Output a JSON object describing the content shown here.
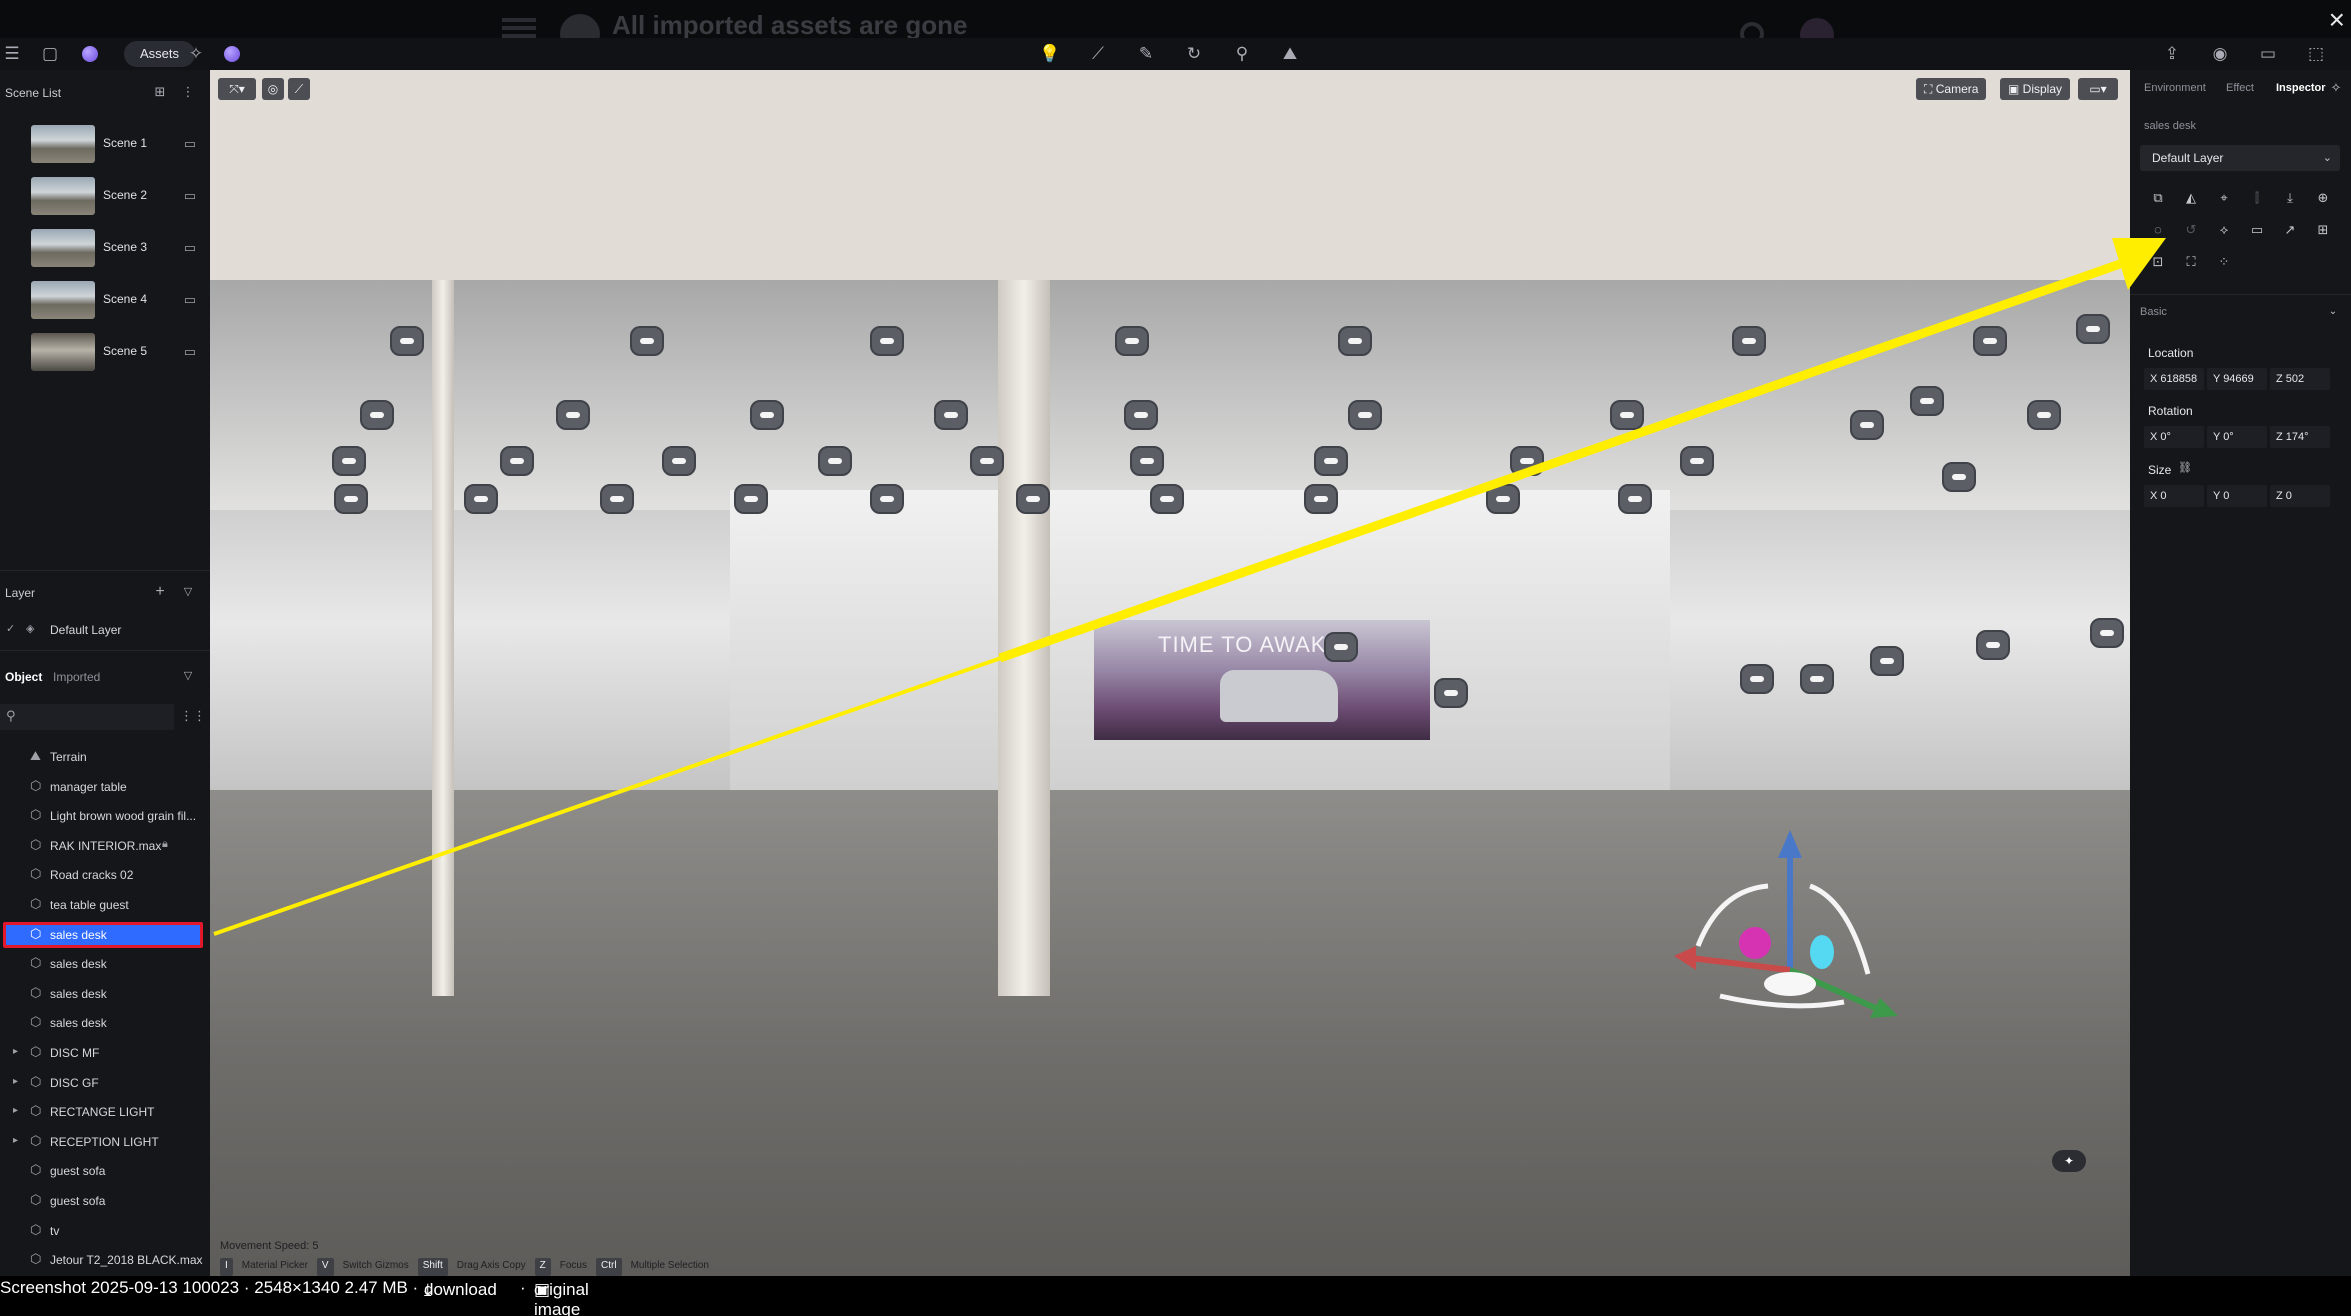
{
  "banner": {
    "title": "All imported assets are gone",
    "close_icon": "×"
  },
  "toolbar": {
    "assets_label": "Assets",
    "center_tools": [
      "lightbulb-icon",
      "measure-icon",
      "brush-icon",
      "rotate-icon",
      "path-icon",
      "terrain-icon"
    ]
  },
  "scene_list": {
    "title": "Scene List",
    "scenes": [
      {
        "label": "Scene 1"
      },
      {
        "label": "Scene 2"
      },
      {
        "label": "Scene 3"
      },
      {
        "label": "Scene 4"
      },
      {
        "label": "Scene 5"
      }
    ]
  },
  "layer": {
    "title": "Layer",
    "default_layer": "Default Layer"
  },
  "objects": {
    "tabs": {
      "object": "Object",
      "imported": "Imported"
    },
    "items": [
      {
        "label": "Terrain",
        "expandable": false,
        "selected": false
      },
      {
        "label": "manager table",
        "expandable": false,
        "selected": false
      },
      {
        "label": "Light brown wood grain fil...",
        "expandable": false,
        "selected": false
      },
      {
        "label": "RAK INTERIOR.max",
        "expandable": false,
        "selected": false
      },
      {
        "label": "Road cracks 02",
        "expandable": false,
        "selected": false
      },
      {
        "label": "tea table guest",
        "expandable": false,
        "selected": false
      },
      {
        "label": "sales desk",
        "expandable": false,
        "selected": true
      },
      {
        "label": "sales desk",
        "expandable": false,
        "selected": false
      },
      {
        "label": "sales desk",
        "expandable": false,
        "selected": false
      },
      {
        "label": "sales desk",
        "expandable": false,
        "selected": false
      },
      {
        "label": "DISC MF",
        "expandable": true,
        "selected": false
      },
      {
        "label": "DISC GF",
        "expandable": true,
        "selected": false
      },
      {
        "label": "RECTANGE LIGHT",
        "expandable": true,
        "selected": false
      },
      {
        "label": "RECEPTION LIGHT",
        "expandable": true,
        "selected": false
      },
      {
        "label": "guest sofa",
        "expandable": false,
        "selected": false
      },
      {
        "label": "guest sofa",
        "expandable": false,
        "selected": false
      },
      {
        "label": "tv",
        "expandable": false,
        "selected": false
      },
      {
        "label": "Jetour T2_2018 BLACK.max",
        "expandable": false,
        "selected": false
      }
    ]
  },
  "viewport": {
    "camera_label": "Camera",
    "display_label": "Display",
    "banner_text": "TIME TO AWAK",
    "movement_speed": "Movement Speed: 5",
    "shortcuts": [
      {
        "key": "I",
        "label": "Material Picker"
      },
      {
        "key": "V",
        "label": "Switch Gizmos"
      },
      {
        "key": "Shift",
        "label": "Drag Axis Copy"
      },
      {
        "key": "Z",
        "label": "Focus"
      },
      {
        "key": "Ctrl",
        "label": "Multiple Selection"
      }
    ]
  },
  "inspector": {
    "tabs": {
      "environment": "Environment",
      "effect": "Effect",
      "inspector": "Inspector"
    },
    "object_name": "sales desk",
    "layer": "Default Layer",
    "section": "Basic",
    "location_label": "Location",
    "location": {
      "x": "X 618858",
      "y": "Y 94669",
      "z": "Z 502"
    },
    "rotation_label": "Rotation",
    "rotation": {
      "x": "X 0°",
      "y": "Y 0°",
      "z": "Z 174°"
    },
    "size_label": "Size",
    "size": {
      "x": "X 0",
      "y": "Y 0",
      "z": "Z 0"
    }
  },
  "statusbar": {
    "info": "Screenshot 2025-09-13 100023 · 2548×1340 2.47 MB ·",
    "download": "download",
    "sep": "·",
    "original": "original image"
  },
  "colors": {
    "accent": "#2f6bff",
    "selection_outline": "#e3172a",
    "annotation_arrow": "#ffee00"
  }
}
